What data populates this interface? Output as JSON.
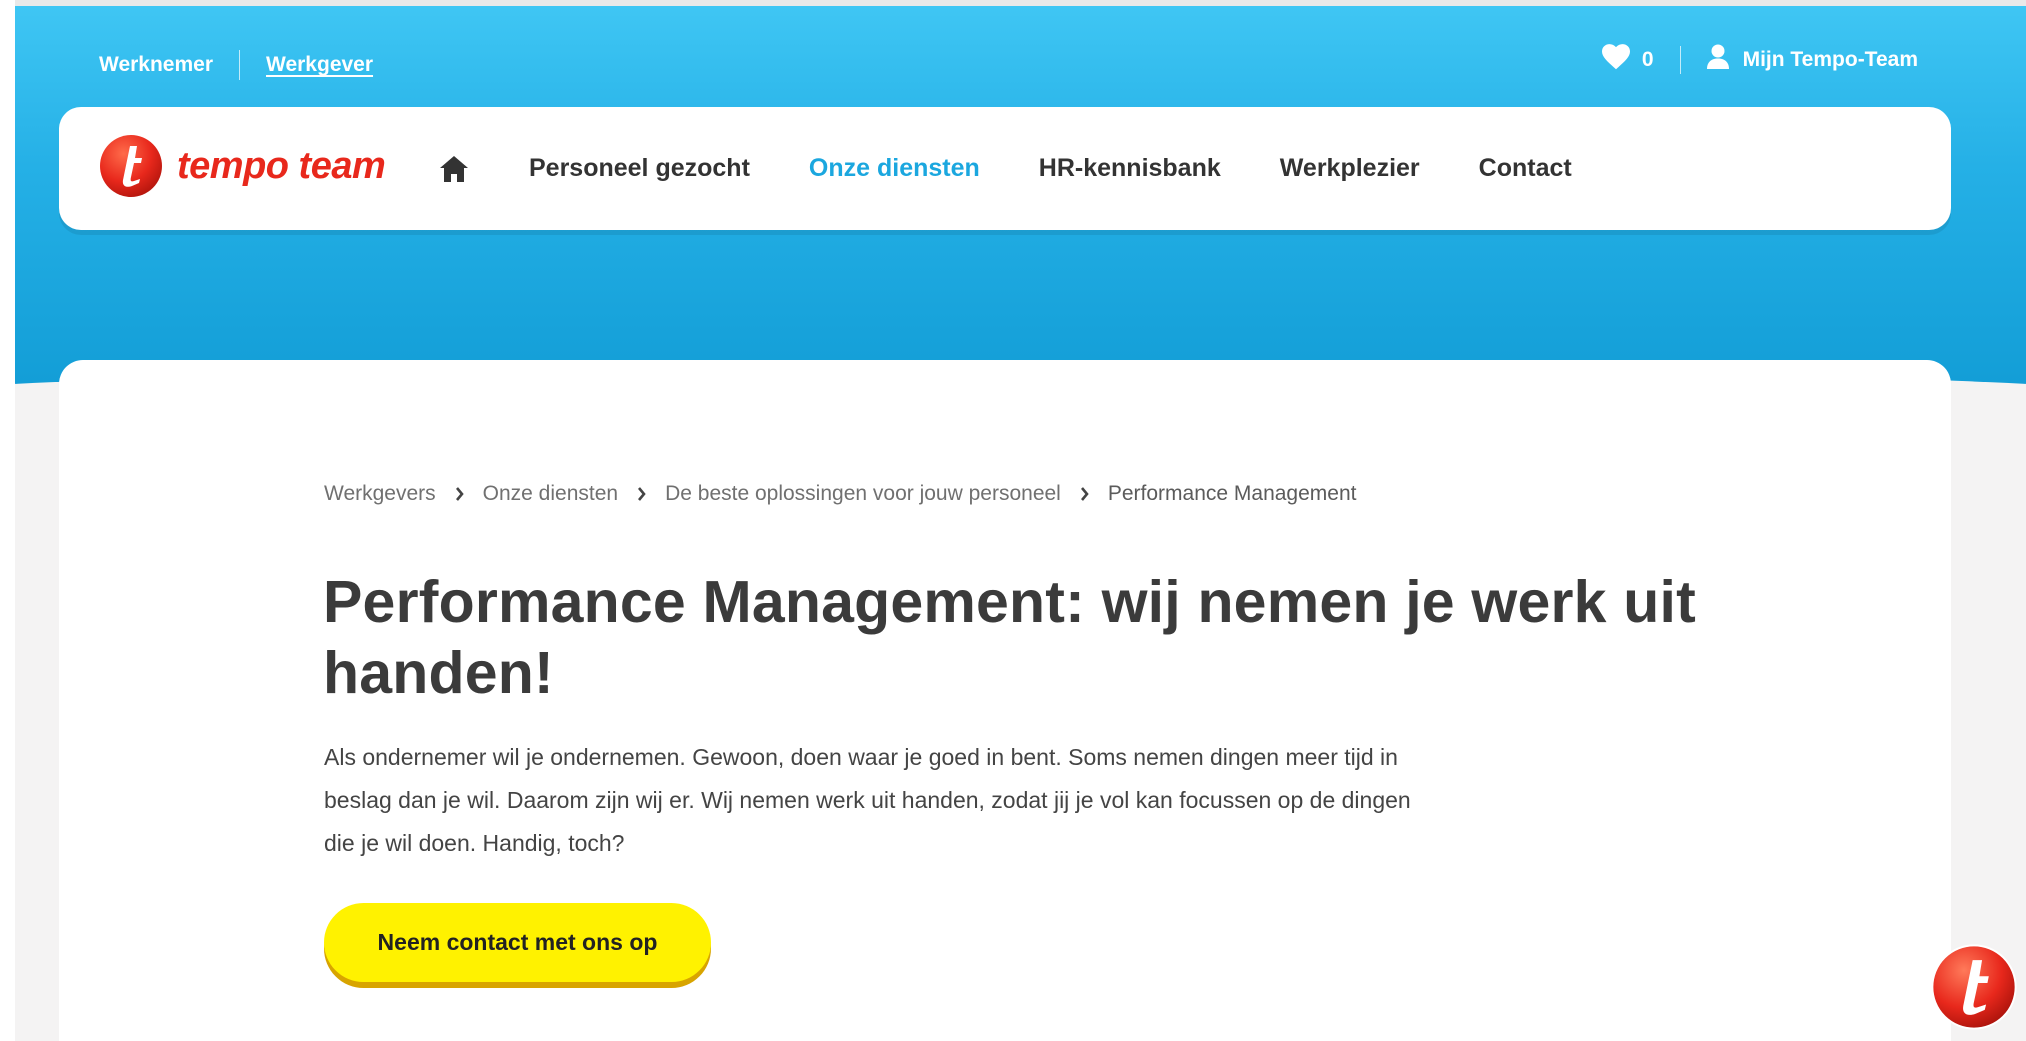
{
  "topbar": {
    "werknemer": "Werknemer",
    "werkgever": "Werkgever",
    "favorites_count": "0",
    "account_label": "Mijn Tempo-Team"
  },
  "logo": {
    "text": "tempo team"
  },
  "nav": {
    "items": [
      {
        "label": "Personeel gezocht"
      },
      {
        "label": "Onze diensten"
      },
      {
        "label": "HR-kennisbank"
      },
      {
        "label": "Werkplezier"
      },
      {
        "label": "Contact"
      }
    ],
    "active": "Onze diensten"
  },
  "breadcrumb": [
    "Werkgevers",
    "Onze diensten",
    "De beste oplossingen voor jouw personeel",
    "Performance Management"
  ],
  "main": {
    "title": "Performance Management: wij nemen je werk uit handen!",
    "lead_lines": [
      "Als ondernemer wil je ondernemen. Gewoon, doen waar je goed in bent. Soms nemen dingen meer tijd in",
      "beslag dan je wil. Daarom zijn wij er. Wij nemen werk uit handen, zodat jij je vol kan focussen op de dingen",
      "die je wil doen. Handig, toch?"
    ],
    "cta_label": "Neem contact met ons op"
  },
  "colors": {
    "brand_blue": "#1ba7df",
    "brand_red": "#e8281c",
    "cta_yellow": "#fff200"
  }
}
